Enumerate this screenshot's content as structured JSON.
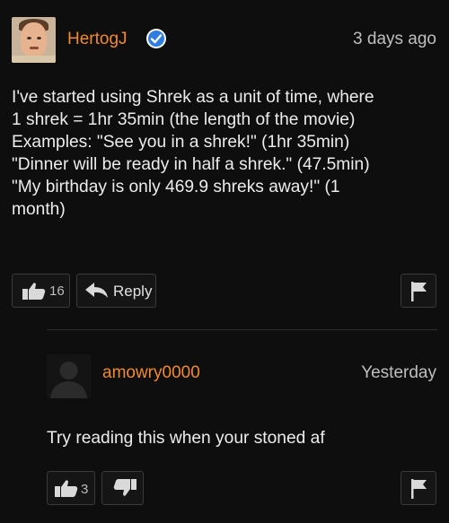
{
  "comment": {
    "username": "HertogJ",
    "timestamp": "3 days ago",
    "lines": [
      "I've started using Shrek as a unit of time, where",
      "1 shrek = 1hr 35min (the length of the movie)",
      "Examples: \"See you in a shrek!\" (1hr 35min)",
      "\"Dinner will be ready in half a shrek.\" (47.5min)",
      "\"My birthday is only 469.9 shreks away!\" (1",
      "month)"
    ],
    "like_count": "16",
    "reply_label": "Reply"
  },
  "reply": {
    "username": "amowry0000",
    "timestamp": "Yesterday",
    "text": "Try reading this when your stoned af",
    "like_count": "3"
  },
  "icons": {
    "verified": "verified-check-icon",
    "like": "thumbs-up-icon",
    "dislike": "thumbs-down-icon",
    "reply": "reply-arrow-icon",
    "flag": "flag-icon"
  },
  "colors": {
    "background": "#0e0e0e",
    "username": "#f28a2b",
    "verified": "#2f7de1",
    "text": "#ececec"
  }
}
